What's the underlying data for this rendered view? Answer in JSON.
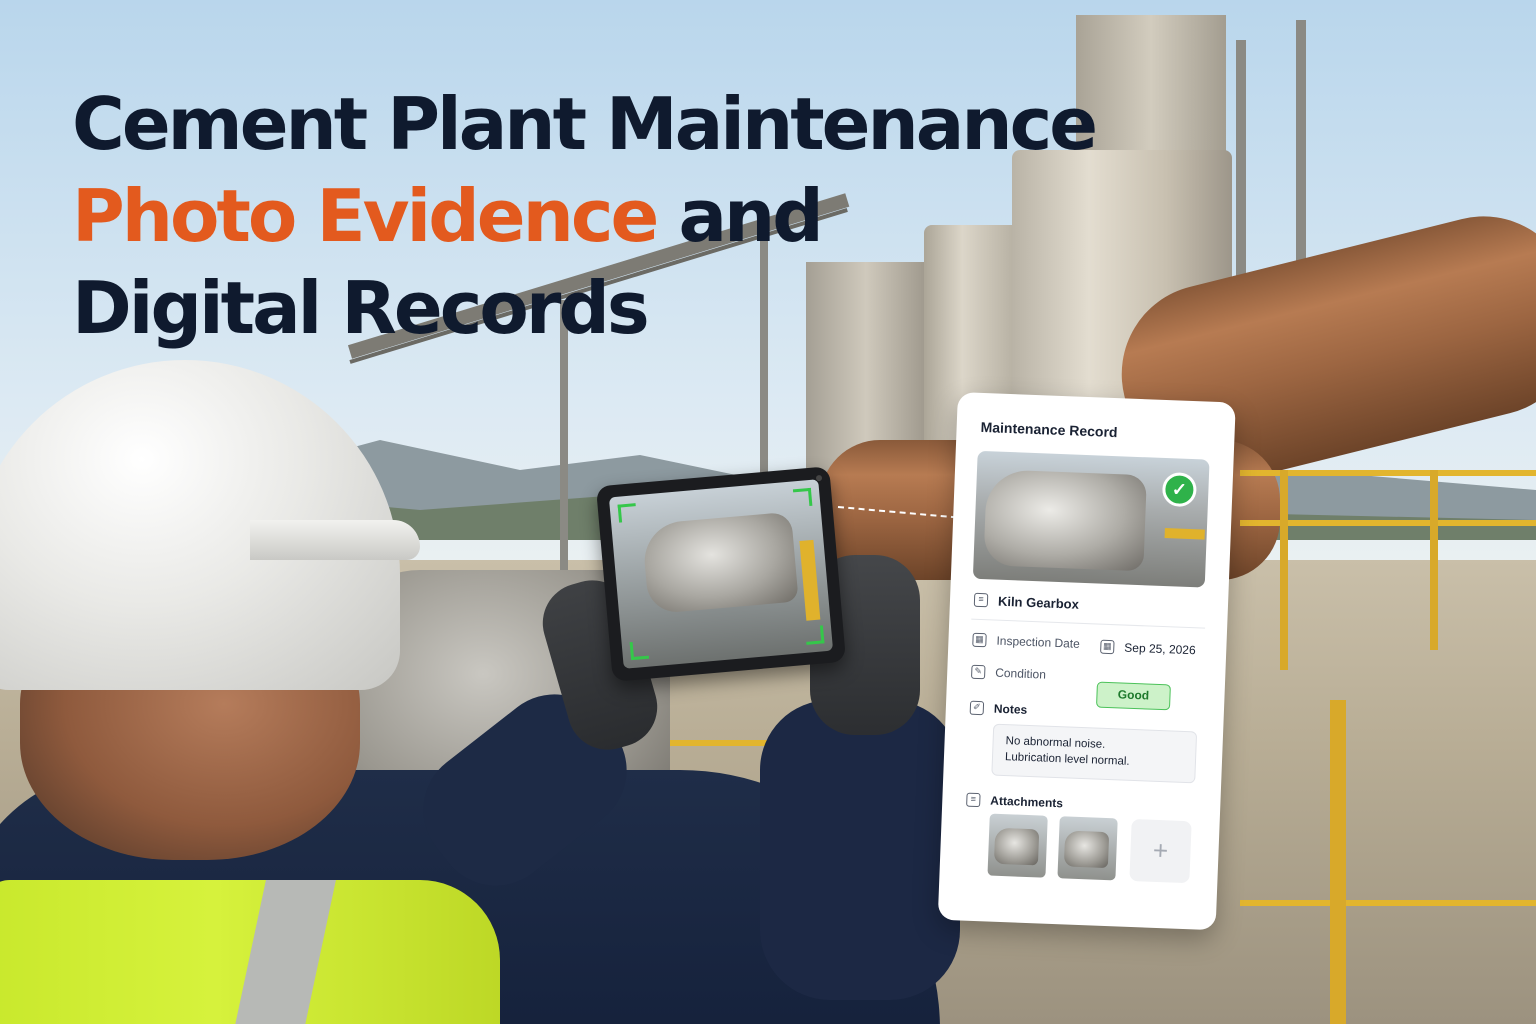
{
  "headline": {
    "line1": "Cement Plant Maintenance",
    "line2_accent": "Photo Evidence",
    "line2_rest": " and",
    "line3": "Digital Records"
  },
  "colors": {
    "headline_dark": "#0f1a2e",
    "headline_accent": "#e35a1e",
    "status_good_bg": "#cdf2c9",
    "status_good_border": "#4cc25a",
    "check_green": "#2fb24a"
  },
  "card": {
    "title": "Maintenance Record",
    "asset_icon": "document-icon",
    "asset_name": "Kiln Gearbox",
    "inspection_date_icon": "calendar-icon",
    "inspection_date_label": "Inspection Date",
    "inspection_date_value": "Sep 25, 2026",
    "condition_icon": "edit-icon",
    "condition_label": "Condition",
    "condition_value": "Good",
    "notes_icon": "notes-icon",
    "notes_label": "Notes",
    "notes_line1": "No abnormal noise.",
    "notes_line2": "Lubrication level normal.",
    "attachments_icon": "paperclip-icon",
    "attachments_label": "Attachments",
    "add_label": "+",
    "verified_icon": "check-icon"
  },
  "tablet": {
    "scan_frame_icon": "scan-frame-icon"
  }
}
